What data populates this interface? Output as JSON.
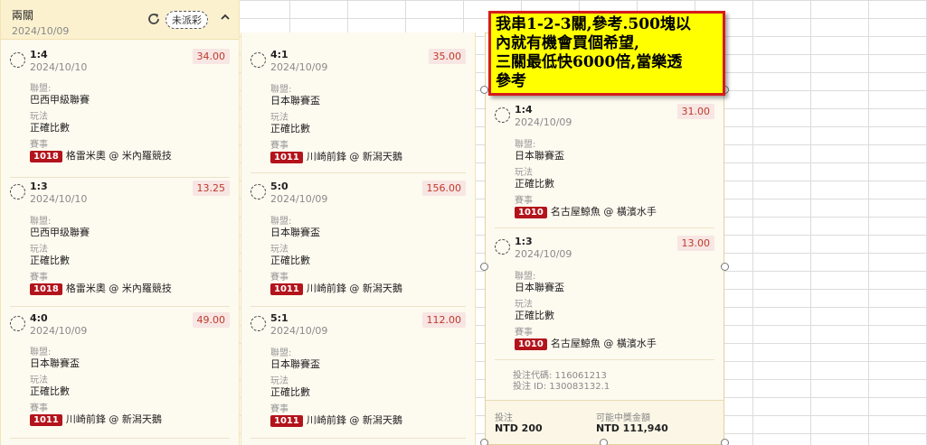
{
  "header": {
    "title": "兩關",
    "date": "2024/10/09",
    "status_tag": "未派彩"
  },
  "labels": {
    "league": "聯盟:",
    "play": "玩法",
    "event": "賽事"
  },
  "column1": [
    {
      "score": "1:4",
      "date": "2024/10/10",
      "odds": "34.00",
      "league": "巴西甲級聯賽",
      "play": "正確比數",
      "code": "1018",
      "match": "格雷米奧 @ 米內羅競技"
    },
    {
      "score": "1:3",
      "date": "2024/10/10",
      "odds": "13.25",
      "league": "巴西甲级聯賽",
      "play": "正確比數",
      "code": "1018",
      "match": "格雷米奧 @ 米內羅競技"
    },
    {
      "score": "4:0",
      "date": "2024/10/09",
      "odds": "49.00",
      "league": "日本聯賽盃",
      "play": "正確比數",
      "code": "1011",
      "match": "川崎前鋒 @ 新潟天鵝"
    }
  ],
  "column2": [
    {
      "score": "4:1",
      "date": "2024/10/09",
      "odds": "35.00",
      "league": "日本聯賽盃",
      "play": "正確比數",
      "code": "1011",
      "match": "川崎前鋒 @ 新潟天鵝"
    },
    {
      "score": "5:0",
      "date": "2024/10/09",
      "odds": "156.00",
      "league": "日本聯賽盃",
      "play": "正確比數",
      "code": "1011",
      "match": "川崎前鋒 @ 新潟天鵝"
    },
    {
      "score": "5:1",
      "date": "2024/10/09",
      "odds": "112.00",
      "league": "日本聯賽盃",
      "play": "正確比數",
      "code": "1011",
      "match": "川崎前鋒 @ 新潟天鵝"
    }
  ],
  "column3": [
    {
      "score": "1:4",
      "date": "2024/10/09",
      "odds": "31.00",
      "league": "日本聯賽盃",
      "play": "正確比數",
      "code": "1010",
      "match": "名古屋鯨魚 @ 橫濱水手"
    },
    {
      "score": "1:3",
      "date": "2024/10/09",
      "odds": "13.00",
      "league": "日本聯賽盃",
      "play": "正確比數",
      "code": "1010",
      "match": "名古屋鯨魚 @ 橫濱水手"
    }
  ],
  "footer": {
    "bet_code": "投注代碼: 116061213",
    "bet_id": "投注 ID: 130083132.1",
    "stake_label": "投注",
    "stake_value": "NTD 200",
    "payout_label": "可能中獎金額",
    "payout_value": "NTD 111,940"
  },
  "annotation": {
    "line1": "我串1-2-3關,參考.500塊以",
    "line2": "內就有機會買個希望,",
    "line3": "三關最低快6000倍,當樂透",
    "line4": "參考"
  },
  "colors": {
    "odds_text": "#c0392b",
    "badge_bg": "#b3131b",
    "annotation_bg": "#ffff00",
    "annotation_border": "#d51b1b",
    "panel_bg": "#fdfaf0"
  }
}
